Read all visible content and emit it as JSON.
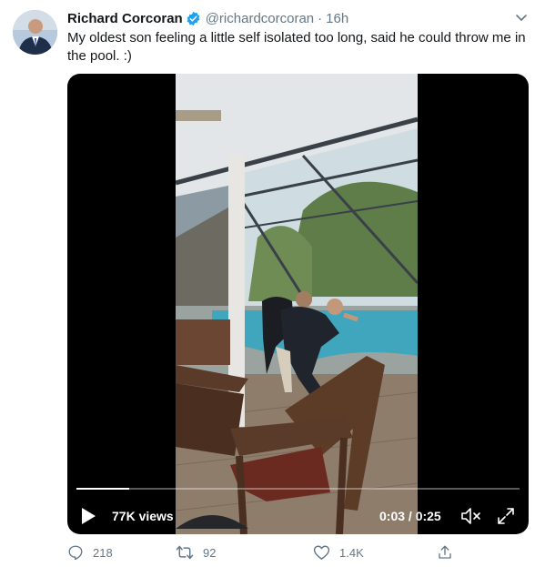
{
  "tweet": {
    "author_name": "Richard Corcoran",
    "handle": "@richardcorcoran",
    "separator": "·",
    "time": "16h",
    "verified": true,
    "text": "My oldest son feeling a little self isolated too long, said he could throw me in the pool. :)"
  },
  "video": {
    "views": "77K views",
    "time_readout": "0:03 / 0:25",
    "progress": 0.12
  },
  "actions": {
    "replies": "218",
    "retweets": "92",
    "likes": "1.4K"
  },
  "colors": {
    "accent": "#1da1f2",
    "muted": "#657786",
    "text": "#14171a"
  },
  "icons": [
    "verified-badge-icon",
    "chevron-down-icon",
    "play-icon",
    "volume-muted-icon",
    "fullscreen-icon",
    "reply-icon",
    "retweet-icon",
    "like-icon",
    "share-icon"
  ]
}
